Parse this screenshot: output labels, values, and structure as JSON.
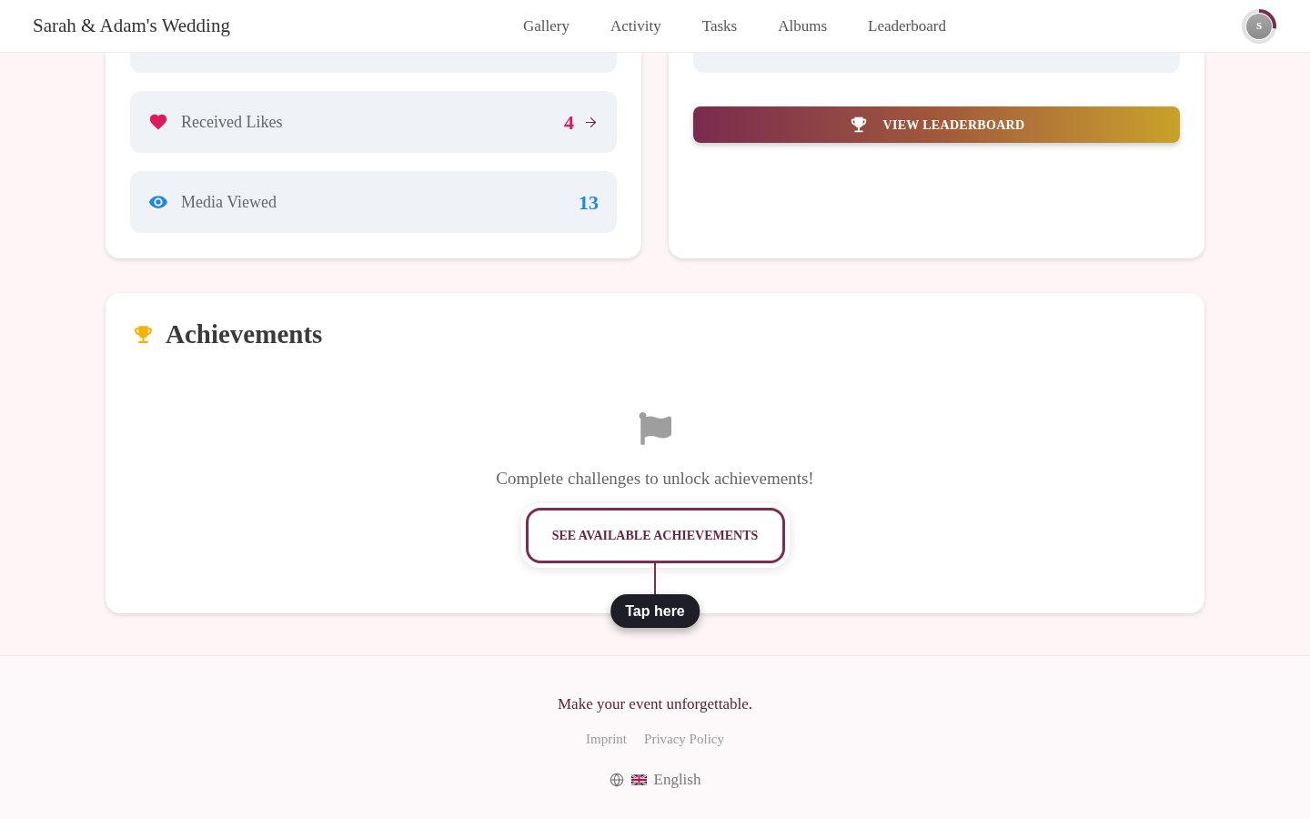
{
  "header": {
    "title": "Sarah & Adam's Wedding",
    "nav": [
      "Gallery",
      "Activity",
      "Tasks",
      "Albums",
      "Leaderboard"
    ],
    "avatar": {
      "initial": "S"
    }
  },
  "stats": [
    {
      "kind": "likes",
      "label": "Received Likes",
      "value": "4",
      "color": "#e0195f",
      "arrow": true
    },
    {
      "kind": "views",
      "label": "Media Viewed",
      "value": "13",
      "color": "#1e88e5",
      "arrow": false
    }
  ],
  "progress": {
    "leaderboard_button": "VIEW LEADERBOARD"
  },
  "achievements": {
    "title": "Achievements",
    "empty_message": "Complete challenges to unlock achievements!",
    "button": "SEE AVAILABLE ACHIEVEMENTS",
    "tooltip": "Tap here"
  },
  "footer": {
    "tagline": "Make your event unforgettable.",
    "links": [
      "Imprint",
      "Privacy Policy"
    ],
    "language": "English"
  }
}
